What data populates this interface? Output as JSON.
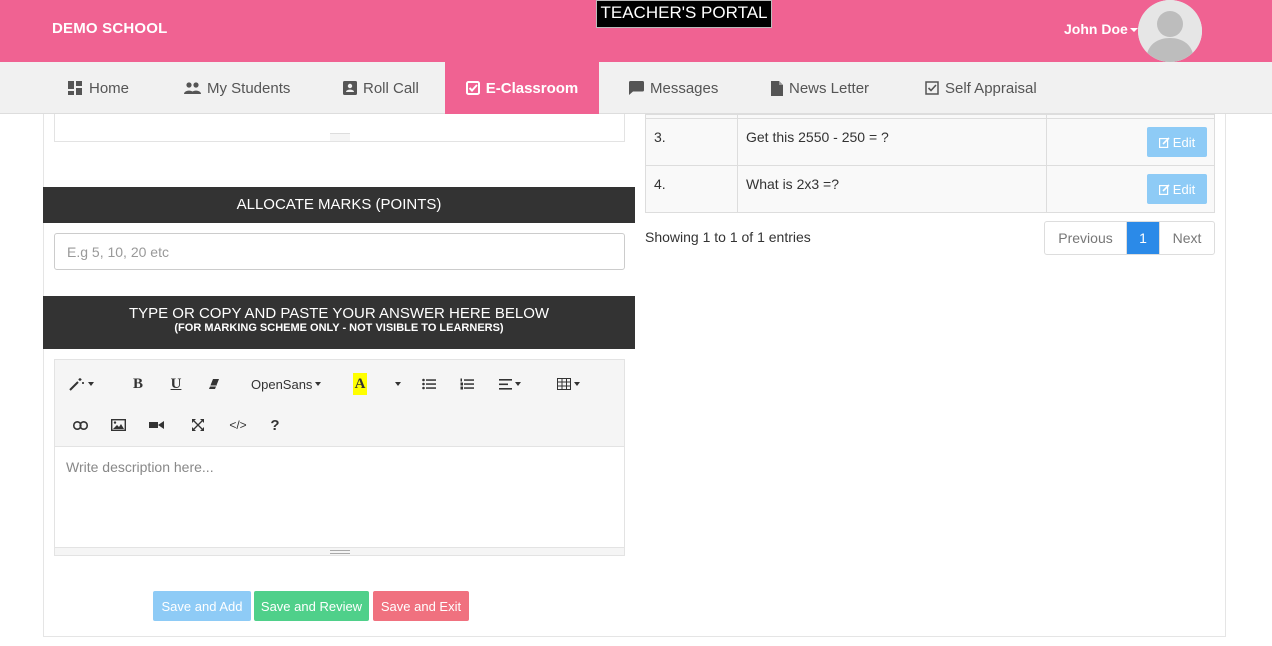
{
  "header": {
    "brand": "DEMO SCHOOL",
    "portal_title": "TEACHER'S PORTAL",
    "user_name": "John Doe",
    "accent_color": "#f06292"
  },
  "nav": {
    "items": [
      {
        "label": "Home",
        "icon": "dashboard-icon"
      },
      {
        "label": "My Students",
        "icon": "people-icon"
      },
      {
        "label": "Roll Call",
        "icon": "contact-card-icon"
      },
      {
        "label": "E-Classroom",
        "icon": "check-square-icon",
        "active": true
      },
      {
        "label": "Messages",
        "icon": "chat-icon"
      },
      {
        "label": "News Letter",
        "icon": "document-icon"
      },
      {
        "label": "Self Appraisal",
        "icon": "check-box-icon"
      }
    ]
  },
  "allocate": {
    "title": "ALLOCATE MARKS (POINTS)",
    "placeholder": "E.g 5, 10, 20 etc"
  },
  "answer": {
    "title": "TYPE OR COPY AND PASTE YOUR ANSWER HERE BELOW",
    "subtitle": "(FOR MARKING SCHEME ONLY - NOT VISIBLE TO LEARNERS)",
    "toolbar": {
      "font_name": "OpenSans",
      "bold": "B",
      "underline": "U",
      "highlight": "A",
      "help": "?",
      "code": "</>"
    },
    "placeholder": "Write description here..."
  },
  "actions": {
    "save_add": "Save and Add",
    "save_review": "Save and Review",
    "save_exit": "Save and Exit"
  },
  "questions": {
    "rows": [
      {
        "num": "3.",
        "text": "Get  this 2550 - 250 = ?",
        "action": "Edit"
      },
      {
        "num": "4.",
        "text": "What is 2x3 =?",
        "action": "Edit"
      }
    ],
    "info": "Showing 1 to 1 of 1 entries",
    "pager": {
      "prev": "Previous",
      "page": "1",
      "next": "Next"
    }
  }
}
